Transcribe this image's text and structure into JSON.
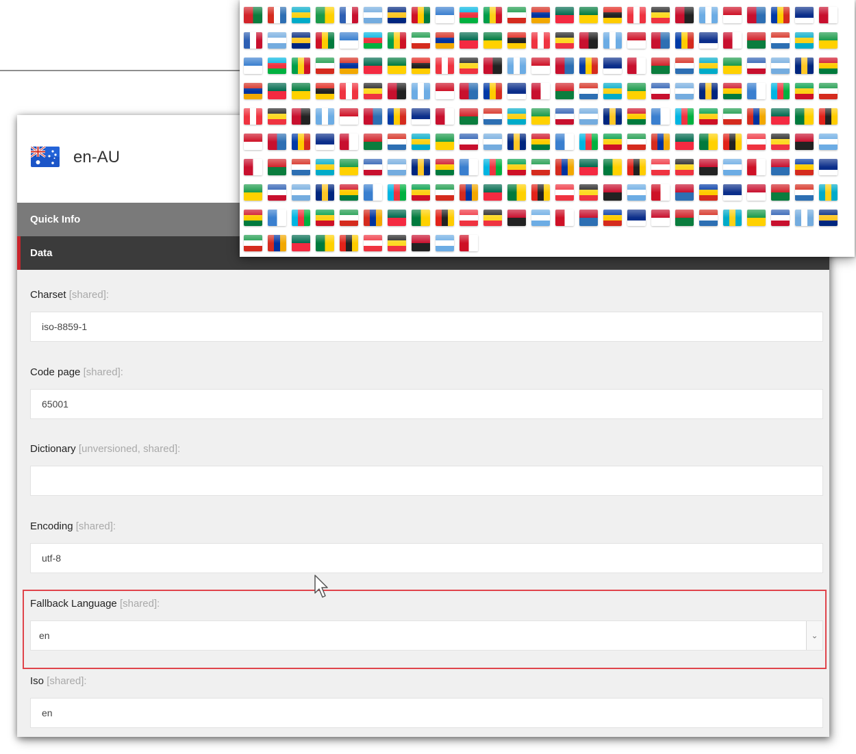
{
  "item": {
    "title": "en-AU",
    "flag_icon": "australia-flag-icon"
  },
  "sections": {
    "quick_info": "Quick Info",
    "data": "Data"
  },
  "fields": {
    "charset": {
      "label": "Charset",
      "hint": "[shared]:",
      "value": "iso-8859-1"
    },
    "code_page": {
      "label": "Code page",
      "hint": "[shared]:",
      "value": "65001"
    },
    "dictionary": {
      "label": "Dictionary",
      "hint": "[unversioned, shared]:",
      "value": ""
    },
    "encoding": {
      "label": "Encoding",
      "hint": "[shared]:",
      "value": "utf-8"
    },
    "fallback_language": {
      "label": "Fallback Language",
      "hint": "[shared]:",
      "value": "en"
    },
    "iso": {
      "label": "Iso",
      "hint": "[shared]:",
      "value": "en"
    }
  },
  "colors": {
    "quick_info_bg": "#7a7a7a",
    "data_bg": "#3b3b3b",
    "accent_red": "#c9252c",
    "highlight_border": "#e0434a"
  },
  "flag_picker": {
    "rows": 10,
    "columns": 25,
    "flag_count": 235,
    "palette": [
      [
        "#d2232a",
        "#0b7d3e"
      ],
      [
        "#c8102e",
        "#222222"
      ],
      [
        "#1a9a4a",
        "#ffffff",
        "#d52b1e"
      ],
      [
        "#2d5fb3",
        "#ffffff",
        "#c8102e"
      ],
      [
        "#0039a6",
        "#ffcc00",
        "#d52b1e"
      ],
      [
        "#e2231a",
        "#222222",
        "#ffcc00"
      ],
      [
        "#3a7fcf",
        "#ffffff"
      ],
      [
        "#d52b1e",
        "#ffffff",
        "#2d6fb3"
      ],
      [
        "#6cace4",
        "#ffffff",
        "#6cace4"
      ],
      [
        "#d52b1e",
        "#0033a0",
        "#f2a800"
      ],
      [
        "#74acdf",
        "#ffffff",
        "#74acdf"
      ],
      [
        "#0b2e8a",
        "#0b2e8a",
        "#ffffff"
      ],
      [
        "#ef3340",
        "#ffffff",
        "#ef3340"
      ],
      [
        "#00b5e2",
        "#ef3340",
        "#00b140"
      ],
      [
        "#00abc9",
        "#fcd116",
        "#00abc9"
      ],
      [
        "#ce1126",
        "#ffffff"
      ],
      [
        "#006a4e",
        "#f42a41"
      ],
      [
        "#00267f",
        "#ffc726",
        "#00267f"
      ],
      [
        "#c8102e",
        "#ffffff"
      ],
      [
        "#222222",
        "#fdda24",
        "#ef3340"
      ],
      [
        "#009e49",
        "#fcd116",
        "#ce1126"
      ],
      [
        "#1a9a4a",
        "#ffd100"
      ],
      [
        "#c8102e",
        "#2d6fb3"
      ],
      [
        "#007a3d",
        "#ffd100"
      ],
      [
        "#ce1126",
        "#ffcc00",
        "#007a3d"
      ]
    ]
  }
}
